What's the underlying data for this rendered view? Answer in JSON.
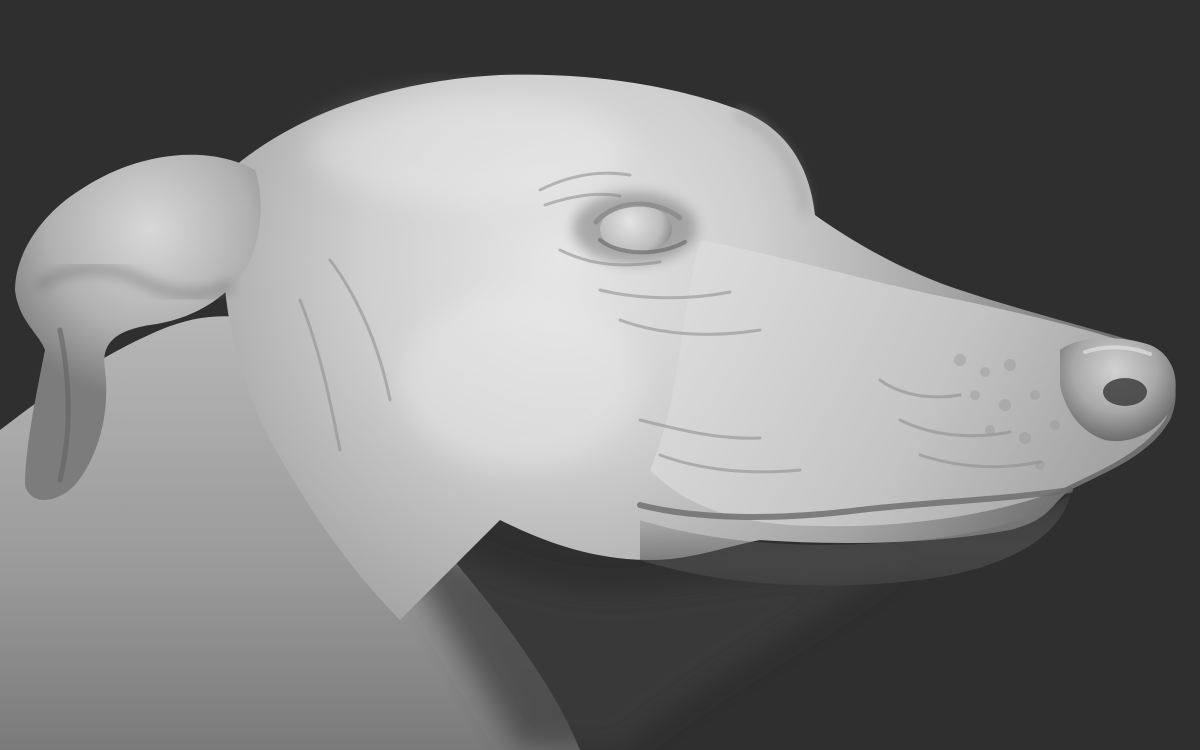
{
  "scene": {
    "background_color": "#2f2f2f",
    "clay_color": "#b9b9b9",
    "subject": "greyhound-head-clay-sculpt-icon"
  }
}
